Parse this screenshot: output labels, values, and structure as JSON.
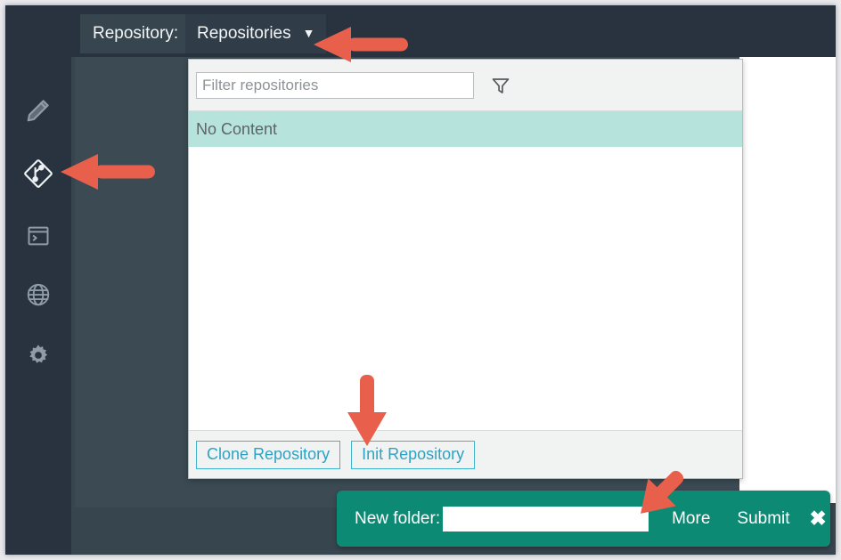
{
  "theme": {
    "sidebar_bg": "#28333f",
    "workarea_bg": "#36454e",
    "accent_green": "#0d8a74",
    "accent_cyan": "#2da3c4",
    "selection_teal": "#b7e3dd",
    "arrow_red": "#e8604c"
  },
  "sidebar": {
    "items": [
      {
        "name": "pencil-icon",
        "label": "Edit"
      },
      {
        "name": "git-icon",
        "label": "Git"
      },
      {
        "name": "terminal-icon",
        "label": "Terminal"
      },
      {
        "name": "globe-icon",
        "label": "Browser"
      },
      {
        "name": "gear-icon",
        "label": "Settings"
      }
    ]
  },
  "topbar": {
    "repository_label": "Repository:",
    "dropdown_value": "Repositories",
    "caret": "▼"
  },
  "dropdown": {
    "filter": {
      "value": "",
      "placeholder": "Filter repositories",
      "icon": "funnel-icon"
    },
    "rows": [
      {
        "label": "No Content",
        "selected": true
      }
    ],
    "footer_buttons": [
      {
        "label": "Clone Repository"
      },
      {
        "label": "Init Repository"
      }
    ]
  },
  "new_folder_bar": {
    "label": "New folder:",
    "input_value": "",
    "input_placeholder": "",
    "more_label": "More",
    "submit_label": "Submit",
    "close_label": "✖"
  },
  "annotations": {
    "arrows": [
      {
        "name": "arrow-to-repositories-dropdown",
        "direction": "left"
      },
      {
        "name": "arrow-to-git-sidebar-icon",
        "direction": "left"
      },
      {
        "name": "arrow-to-init-repository",
        "direction": "down"
      },
      {
        "name": "arrow-to-more",
        "direction": "down-right"
      }
    ]
  }
}
